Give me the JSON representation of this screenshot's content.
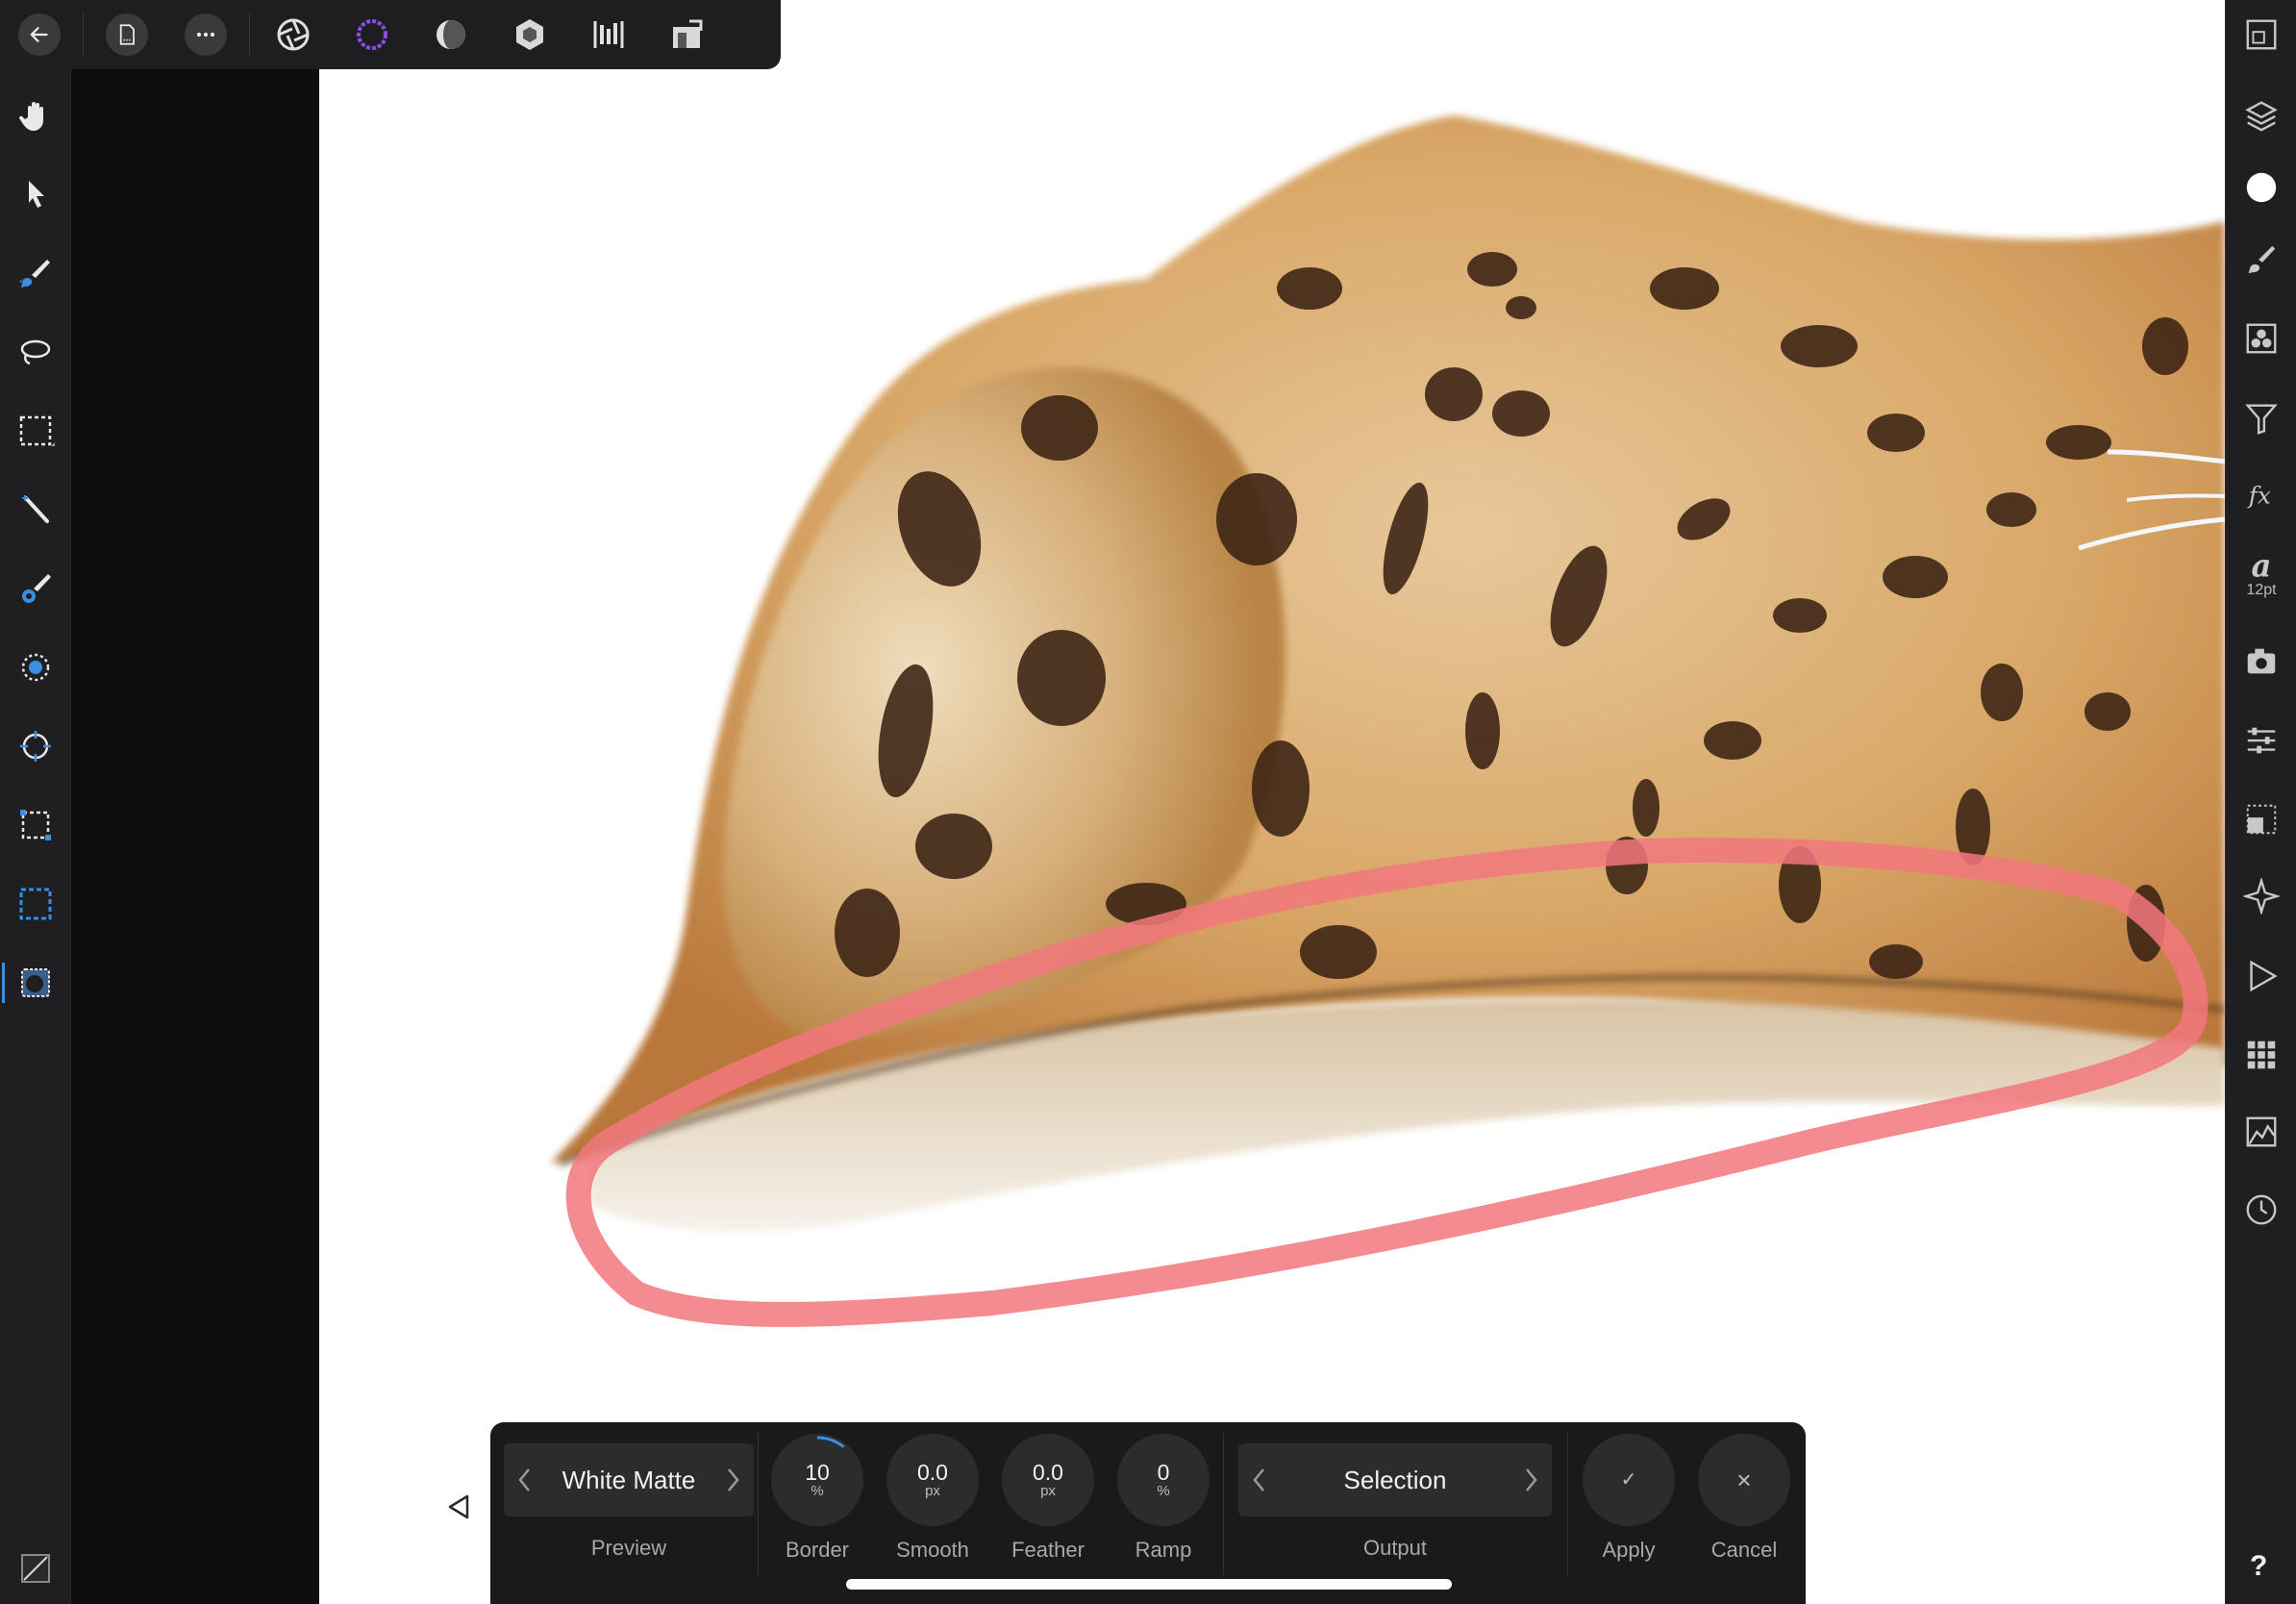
{
  "top_bar": {
    "icons": [
      "back-arrow-icon",
      "document-icon",
      "more-icon",
      "photo-persona-icon",
      "liquify-persona-icon",
      "develop-persona-icon",
      "tone-mapping-persona-icon",
      "export-persona-icon",
      "assistant-icon"
    ]
  },
  "left_toolbar": {
    "tools": [
      "hand-icon",
      "move-icon",
      "selection-brush-icon",
      "freehand-selection-icon",
      "marquee-selection-icon",
      "flood-select-icon",
      "brush-icon",
      "erase-icon",
      "healing-icon",
      "crop-icon",
      "marquee-alt-icon",
      "refine-selection-icon"
    ],
    "active": "refine-selection-icon"
  },
  "right_toolbar": {
    "font_size_label": "12pt",
    "help_label": "?"
  },
  "refine_panel": {
    "preview": {
      "value": "White Matte",
      "label": "Preview"
    },
    "border": {
      "value": "10",
      "unit": "%",
      "label": "Border"
    },
    "smooth": {
      "value": "0.0",
      "unit": "px",
      "label": "Smooth"
    },
    "feather": {
      "value": "0.0",
      "unit": "px",
      "label": "Feather"
    },
    "ramp": {
      "value": "0",
      "unit": "%",
      "label": "Ramp"
    },
    "output": {
      "value": "Selection",
      "label": "Output"
    },
    "apply": {
      "icon": "✓",
      "label": "Apply"
    },
    "cancel": {
      "icon": "×",
      "label": "Cancel"
    }
  },
  "colors": {
    "accent": "#3a8fe0",
    "brush_stroke": "#f2777c",
    "panel": "#1a1a1c"
  }
}
